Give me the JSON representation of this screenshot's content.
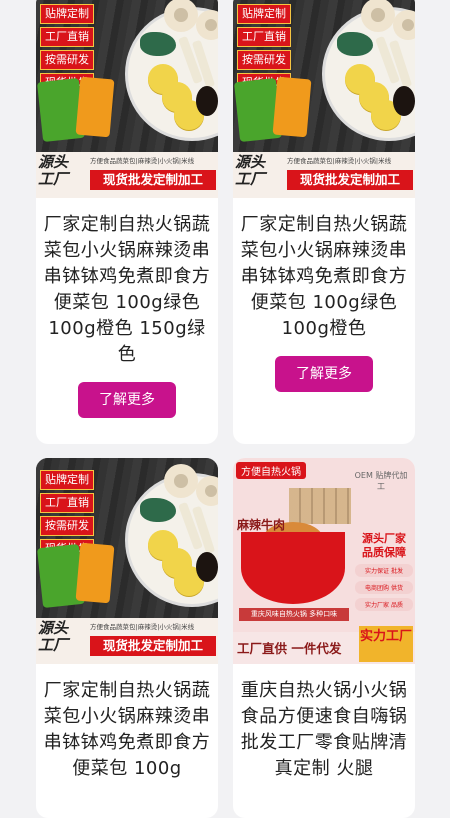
{
  "colors": {
    "accent": "#c8128c",
    "brand_red": "#d9141a",
    "background": "#f2f2f4"
  },
  "cards": [
    {
      "tags": [
        "贴牌定制",
        "工厂直销",
        "按需研发",
        "现货批发"
      ],
      "banner_logo": "源头工厂",
      "banner_sub": "方便食品蔬菜包|麻辣烫|小火锅|米线",
      "banner_main": "现货批发定制加工",
      "title": "厂家定制自热火锅蔬菜包小火锅麻辣烫串串钵钵鸡免煮即食方便菜包 100g绿色 100g橙色 150g绿色",
      "button": "了解更多"
    },
    {
      "tags": [
        "贴牌定制",
        "工厂直销",
        "按需研发",
        "现货批发"
      ],
      "banner_logo": "源头工厂",
      "banner_sub": "方便食品蔬菜包|麻辣烫|小火锅|米线",
      "banner_main": "现货批发定制加工",
      "title": "厂家定制自热火锅蔬菜包小火锅麻辣烫串串钵钵鸡免煮即食方便菜包 100g绿色 100g橙色",
      "button": "了解更多"
    },
    {
      "tags": [
        "贴牌定制",
        "工厂直销",
        "按需研发",
        "现货批发"
      ],
      "banner_logo": "源头工厂",
      "banner_sub": "方便食品蔬菜包|麻辣烫|小火锅|米线",
      "banner_main": "现货批发定制加工",
      "title": "厂家定制自热火锅蔬菜包小火锅麻辣烫串串钵钵鸡免煮即食方便菜包 100g"
    },
    {
      "promo": {
        "badge": "方便自热火锅",
        "oem": "OEM 贴牌代加工",
        "product": "麻辣牛肉",
        "quality": "源头厂家 品质保障",
        "pills": [
          "实力保证 批发",
          "电商团购 供货",
          "实力厂家 品质"
        ],
        "strip": "重庆风味自热火锅 多种口味",
        "factory": "工厂直供 一件代发",
        "big": "实力工厂"
      },
      "title": "重庆自热火锅小火锅食品方便速食自嗨锅批发工厂零食贴牌清真定制 火腿"
    }
  ]
}
